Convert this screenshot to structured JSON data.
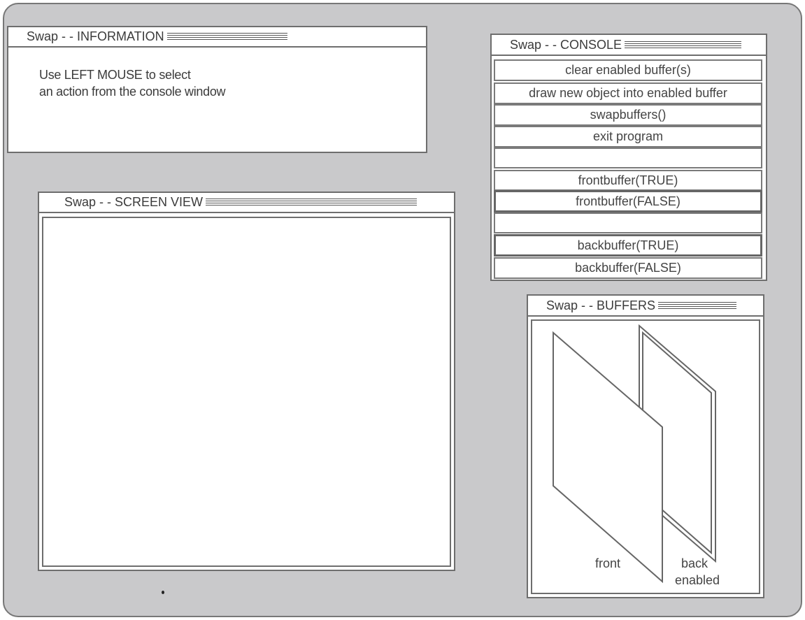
{
  "information_window": {
    "title": "Swap - -  INFORMATION",
    "line1": "Use LEFT  MOUSE to select",
    "line2": "an action from the console window"
  },
  "console_window": {
    "title": "Swap - - CONSOLE",
    "buttons": [
      "clear enabled buffer(s)",
      "draw new object into enabled buffer",
      "swapbuffers()",
      "exit program",
      "",
      "frontbuffer(TRUE)",
      "frontbuffer(FALSE)",
      "",
      "backbuffer(TRUE)",
      "backbuffer(FALSE)"
    ]
  },
  "screen_view_window": {
    "title": "Swap - - SCREEN VIEW"
  },
  "buffers_window": {
    "title": "Swap - - BUFFERS",
    "front_label": "front",
    "back_label": "back",
    "back_status": "enabled"
  },
  "colors": {
    "desktop": "#c9c9cb",
    "window": "#ffffff",
    "border": "#6e6e6e",
    "text": "#3b3b3b"
  }
}
